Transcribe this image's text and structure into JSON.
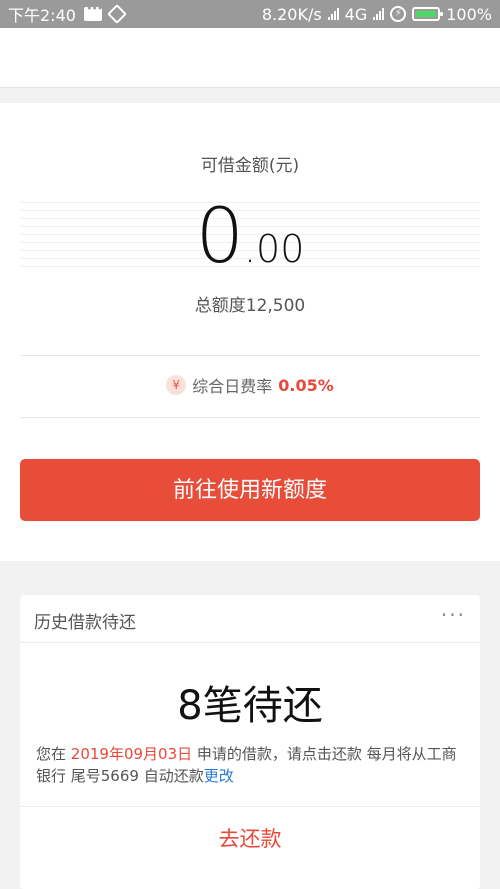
{
  "status_bar": {
    "time": "下午2:40",
    "network_speed": "8.20K/s",
    "network_type": "4G",
    "battery": "100%"
  },
  "amount": {
    "label": "可借金额(元)",
    "integer": "0",
    "decimal": ".00",
    "total_limit_label": "总额度",
    "total_limit_value": "12,500"
  },
  "rate": {
    "icon_glyph": "¥",
    "label": "综合日费率",
    "value": "0.05%"
  },
  "primary_button": "前往使用新额度",
  "history": {
    "title": "历史借款待还",
    "more": "···",
    "pending": "8笔待还",
    "desc_prefix": "您在 ",
    "date": "2019年09月03日",
    "desc_middle": " 申请的借款，请点击还款 每月将从工商银行 尾号5669 自动还款",
    "change_link": "更改",
    "repay_button": "去还款"
  },
  "colors": {
    "accent": "#e84d3a",
    "link": "#2a7ad0"
  }
}
